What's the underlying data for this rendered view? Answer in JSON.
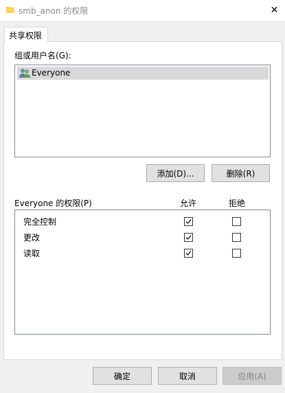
{
  "window": {
    "title": "smb_anon 的权限",
    "folder_icon": "folder-icon",
    "close_label": "✕"
  },
  "tab": {
    "label": "共享权限"
  },
  "users": {
    "label": "组或用户名(G):",
    "items": [
      {
        "name": "Everyone",
        "icon": "users-group-icon",
        "selected": true
      }
    ]
  },
  "buttons": {
    "add": "添加(D)...",
    "remove": "删除(R)",
    "ok": "确定",
    "cancel": "取消",
    "apply": "应用(A)"
  },
  "permissions": {
    "label": "Everyone 的权限(P)",
    "allow_header": "允许",
    "deny_header": "拒绝",
    "rows": [
      {
        "name": "完全控制",
        "allow": true,
        "deny": false
      },
      {
        "name": "更改",
        "allow": true,
        "deny": false
      },
      {
        "name": "读取",
        "allow": true,
        "deny": false
      }
    ]
  },
  "colors": {
    "folder": "#f5c342",
    "selection": "#d9d9d9",
    "border": "#828790"
  }
}
